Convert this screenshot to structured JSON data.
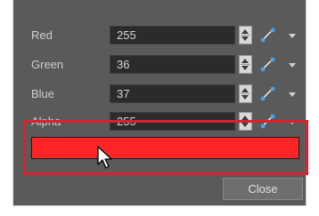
{
  "rows": [
    {
      "label": "Red",
      "value": "255"
    },
    {
      "label": "Green",
      "value": "36"
    },
    {
      "label": "Blue",
      "value": "37"
    },
    {
      "label": "Alpha",
      "value": "255"
    }
  ],
  "swatch_color": "#ff2526",
  "highlight_color": "#e21e2c",
  "close_label": "Close",
  "icons": {
    "function": "function-curve-icon",
    "spinner": "spinner-icon",
    "menu": "dropdown-arrow-icon",
    "cursor": "mouse-cursor-icon"
  }
}
